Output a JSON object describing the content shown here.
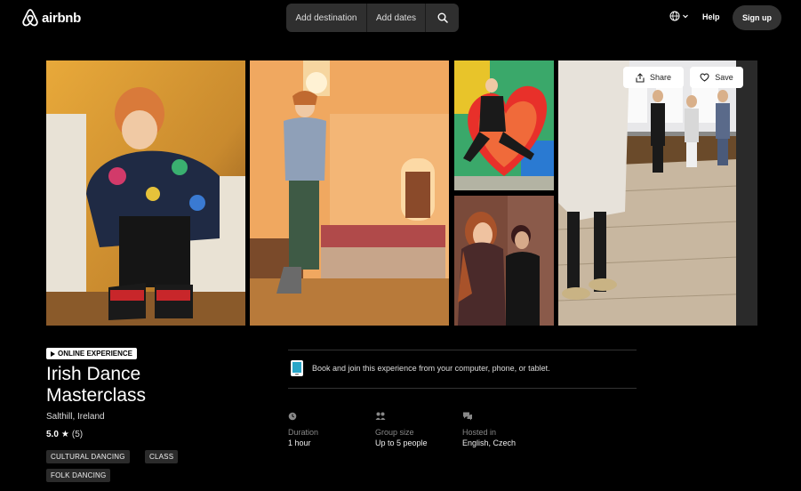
{
  "header": {
    "logo_text": "airbnb",
    "search": {
      "destination_placeholder": "Add destination",
      "dates_placeholder": "Add dates"
    },
    "help_label": "Help",
    "signup_label": "Sign up"
  },
  "actions": {
    "share_label": "Share",
    "save_label": "Save"
  },
  "experience": {
    "badge": "ONLINE EXPERIENCE",
    "title": "Irish Dance Masterclass",
    "location": "Salthill, Ireland",
    "rating": "5.0",
    "review_count": "(5)",
    "tags": [
      "CULTURAL DANCING",
      "CLASS",
      "FOLK DANCING"
    ]
  },
  "details": {
    "device_text": "Book and join this experience from your computer, phone, or tablet.",
    "items": [
      {
        "label": "Duration",
        "value": "1 hour",
        "icon": "clock-icon"
      },
      {
        "label": "Group size",
        "value": "Up to 5 people",
        "icon": "people-icon"
      },
      {
        "label": "Hosted in",
        "value": "English, Czech",
        "icon": "chat-icon"
      }
    ]
  },
  "colors": {
    "background": "#000000",
    "surface": "#2f2f2f",
    "text": "#ffffff",
    "muted": "#888888"
  }
}
